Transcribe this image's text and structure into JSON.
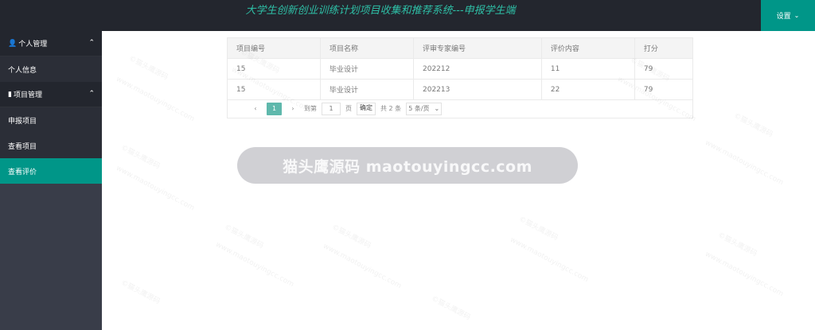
{
  "header": {
    "title": "大学生创新创业训练计划项目收集和推荐系统---申报学生端",
    "settings_label": "设置",
    "settings_icon": "chevron-down-icon"
  },
  "sidebar": {
    "groups": [
      {
        "label": "个人管理",
        "icon": "user-icon",
        "items": [
          {
            "label": "个人信息"
          }
        ]
      },
      {
        "label": "项目管理",
        "icon": "comment-icon",
        "items": [
          {
            "label": "申报项目"
          },
          {
            "label": "查看项目"
          },
          {
            "label": "查看评价",
            "active": true
          }
        ]
      }
    ]
  },
  "table": {
    "columns": [
      "项目编号",
      "项目名称",
      "评审专家编号",
      "评价内容",
      "打分"
    ],
    "rows": [
      [
        "15",
        "毕业设计",
        "202212",
        "11",
        "79"
      ],
      [
        "15",
        "毕业设计",
        "202213",
        "22",
        "79"
      ]
    ]
  },
  "pager": {
    "current": "1",
    "goto_label": "到第",
    "goto_value": "1",
    "page_unit": "页",
    "confirm_label": "确定",
    "total_label": "共 2 条",
    "page_size": "5 条/页"
  },
  "watermark": {
    "banner": "猫头鹰源码 maotouyingcc.com",
    "tile_a": "©猫头鹰源码",
    "tile_b": "www.maotouyingcc.com"
  },
  "colors": {
    "accent": "#009688",
    "header_bg": "#23262e",
    "sidebar_bg": "#393d49",
    "title": "#2ebfa6"
  }
}
